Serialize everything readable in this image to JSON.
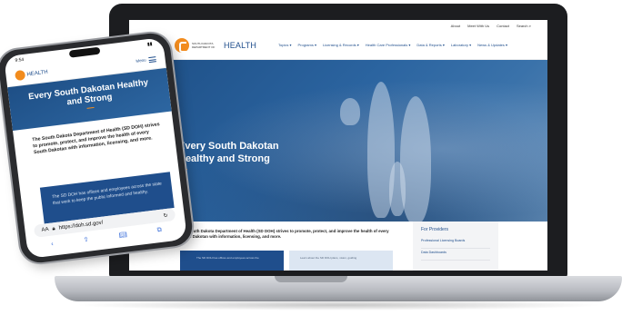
{
  "colors": {
    "brand_blue": "#1f4e8c",
    "brand_orange": "#f28c1e",
    "hero_blue": "#2b64a0"
  },
  "desktop": {
    "utility_links": [
      "About",
      "Meet With Us",
      "Contact",
      "Search"
    ],
    "logo": {
      "small": "South Dakota Department of",
      "big": "HEALTH"
    },
    "nav": [
      "Topics ▾",
      "Programs ▾",
      "Licensing & Records ▾",
      "Health Care Professionals ▾",
      "Data & Reports ▾",
      "Laboratory ▾",
      "News & Updates ▾"
    ],
    "hero_title": "Every South Dakotan Healthy and Strong",
    "intro": "The South Dakota Department of Health (SD DOH) strives to promote, protect, and improve the health of every South Dakotan with information, licensing, and more.",
    "card_blue_text": "The SD DOH has offices and employees across the",
    "card_light_text": "Learn about the SD DOH plans, vision, guiding",
    "aside": {
      "title": "For Providers",
      "links": [
        "Professional Licensing Boards",
        "Data Dashboards"
      ]
    }
  },
  "phone": {
    "time": "9:54",
    "logo_text": "HEALTH",
    "menu_label": "Menu",
    "hero_title": "Every South Dakotan Healthy and Strong",
    "intro": "The South Dakota Department of Health (SD DOH) strives to promote, protect, and improve the health of every South Dakotan with information, licensing, and more.",
    "blue_text": "The SD DOH has offices and employees across the state that work to keep the public informed and healthy.",
    "url": "https://doh.sd.gov/",
    "aa": "AA",
    "reload_icon": "reload-icon",
    "toolbar_icons": [
      "back-icon",
      "share-icon",
      "bookmarks-icon",
      "tabs-icon"
    ]
  }
}
